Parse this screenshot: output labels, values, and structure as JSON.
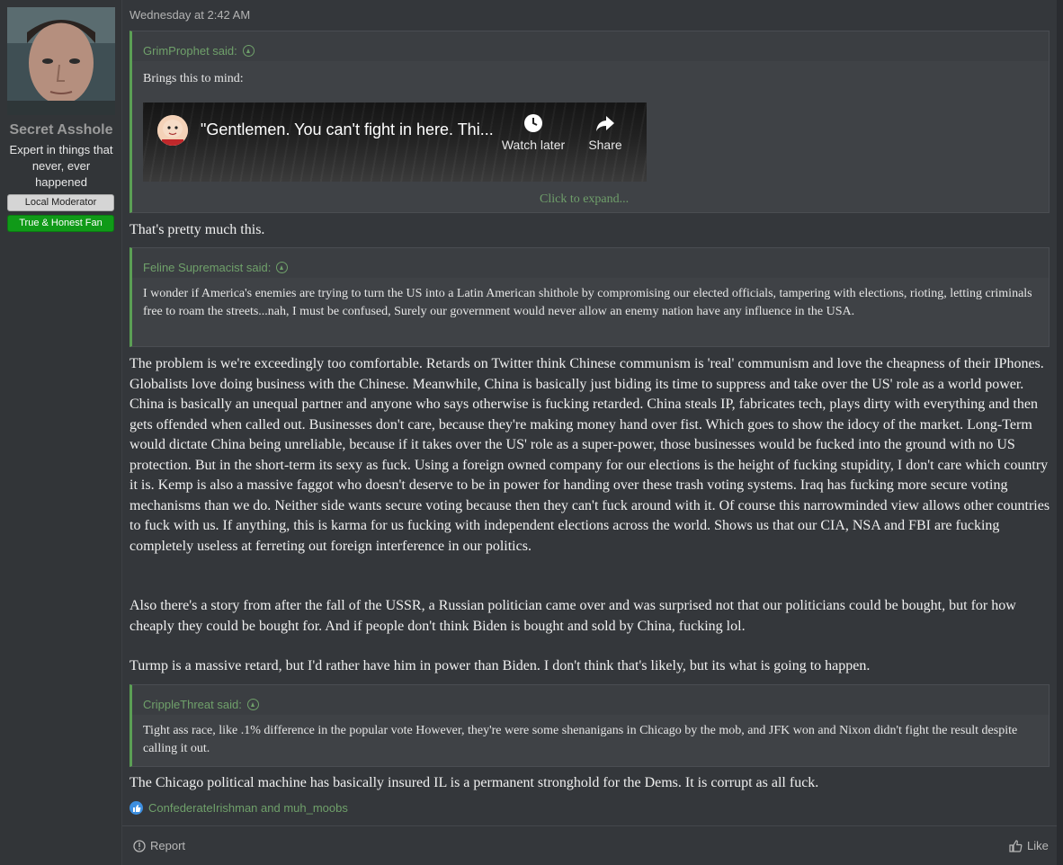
{
  "user": {
    "name": "Secret Asshole",
    "title": "Expert in things that never, ever happened",
    "banners": [
      "Local Moderator",
      "True & Honest Fan"
    ]
  },
  "post": {
    "timestamp": "Wednesday at 2:42 AM",
    "quote1": {
      "author": "GrimProphet said:",
      "text": "Brings this to mind:",
      "video": {
        "title": "\"Gentlemen. You can't fight in here. Thi...",
        "watch_later": "Watch later",
        "share": "Share"
      },
      "expand": "Click to expand..."
    },
    "reply1": "That's pretty much this.",
    "quote2": {
      "author": "Feline Supremacist said:",
      "text": "I wonder if America's enemies are trying to turn the US into a Latin American shithole by compromising our elected officials, tampering with elections, rioting, letting criminals free to roam the streets...nah, I must be confused, Surely our government would never allow an enemy nation have any influence in the USA."
    },
    "paragraph1": "The problem is we're exceedingly too comfortable. Retards on Twitter think Chinese communism is 'real' communism and love the cheapness of their IPhones. Globalists love doing business with the Chinese. Meanwhile, China is basically just biding its time to suppress and take over the US' role as a world power. China is basically an unequal partner and anyone who says otherwise is fucking retarded. China steals IP, fabricates tech, plays dirty with everything and then gets offended when called out. Businesses don't care, because they're making money hand over fist. Which goes to show the idocy of the market. Long-Term would dictate China being unreliable, because if it takes over the US' role as a super-power, those businesses would be fucked into the ground with no US protection. But in the short-term its sexy as fuck. Using a foreign owned company for our elections is the height of fucking stupidity, I don't care which country it is. Kemp is also a massive faggot who doesn't deserve to be in power for handing over these trash voting systems. Iraq has fucking more secure voting mechanisms than we do. Neither side wants secure voting because then they can't fuck around with it. Of course this narrowminded view allows other countries to fuck with us. If anything, this is karma for us fucking with independent elections across the world. Shows us that our CIA, NSA and FBI are fucking completely useless at ferreting out foreign interference in our politics.",
    "paragraph2": "Also there's a story from after the fall of the USSR, a Russian politician came over and was surprised not that our politicians could be bought, but for how cheaply they could be bought for. And if people don't think Biden is bought and sold by China, fucking lol.",
    "paragraph3": "Turmp is a massive retard, but I'd rather have him in power than Biden. I don't think that's likely, but its what is going to happen.",
    "quote3": {
      "author": "CrippleThreat said:",
      "text": "Tight ass race, like .1% difference in the popular vote However, they're were some shenanigans in Chicago by the mob, and JFK won and Nixon didn't fight the result despite calling it out."
    },
    "reply2": "The Chicago political machine has basically insured IL is a permanent stronghold for the Dems. It is corrupt as all fuck.",
    "reactions": "ConfederateIrishman and muh_moobs",
    "report_label": "Report",
    "like_label": "Like"
  },
  "colors": {
    "background": "#34373b",
    "quote_border": "#5b9f54",
    "link_green": "#6fa06a",
    "fan_banner": "#109a18",
    "like_badge": "#3d8fe0"
  },
  "icons": [
    "up-arrow-icon",
    "clock-icon",
    "share-icon",
    "like-reaction-icon",
    "report-icon",
    "thumbs-up-icon"
  ]
}
